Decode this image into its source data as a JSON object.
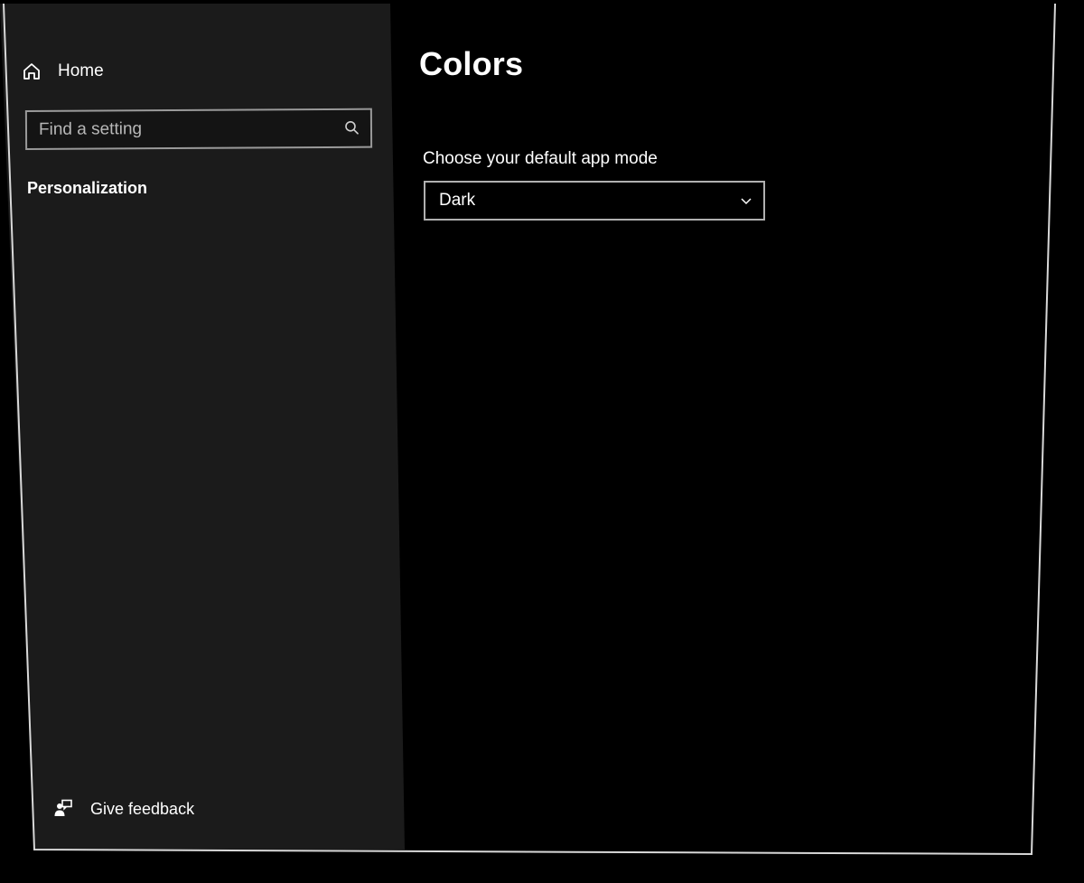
{
  "sidebar": {
    "home_label": "Home",
    "home_icon": "home-icon",
    "search_placeholder": "Find a setting",
    "search_icon": "search-icon",
    "section_label": "Personalization",
    "feedback_label": "Give feedback",
    "feedback_icon": "feedback-icon",
    "background_color": "#1b1b1b"
  },
  "main": {
    "title": "Colors",
    "app_mode": {
      "label": "Choose your default app mode",
      "selected": "Dark",
      "chevron_icon": "chevron-down-icon"
    },
    "background_color": "#000000"
  },
  "theme": {
    "frame_color": "#d8d8d8",
    "text_color": "#ffffff",
    "border_color": "#b0b0b0"
  }
}
